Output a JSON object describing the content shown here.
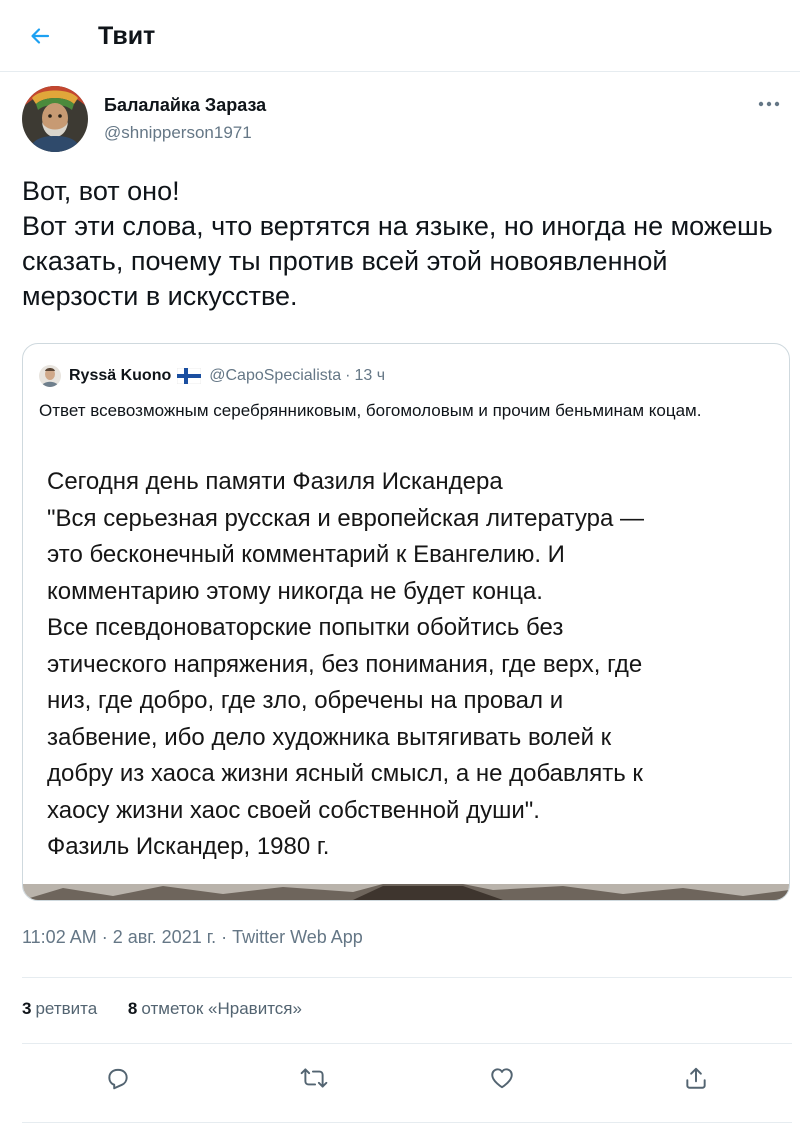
{
  "header": {
    "title": "Твит",
    "back_icon": "arrow-left-icon",
    "accent_color": "#1da1f2"
  },
  "tweet": {
    "author_name": "Балалайка Зараза",
    "author_handle": "@shnipperson1971",
    "more_icon": "more-dots-icon",
    "text": "Вот, вот оно!\nВот эти слова, что вертятся на языке, но иногда не можешь сказать, почему ты против всей этой новоявленной мерзости в искусстве.",
    "timestamp": "11:02 AM · 2 авг. 2021 г. · Twitter Web App"
  },
  "quoted_tweet": {
    "author_name": "Ryssä Kuono",
    "flag_icon": "finland-flag-icon",
    "author_handle": "@CapoSpecialista",
    "separator": "·",
    "time": "13 ч",
    "text": "Ответ всевозможным серебрянниковым, богомоловым и прочим беньминам коцам.",
    "image_text": "Сегодня день памяти Фазиля Искандера\n\"Вся серьезная русская и европейская литература —\nэто бесконечный комментарий к Евангелию. И\nкомментарию этому никогда не будет конца.\nВсе псевдоноваторские попытки обойтись без\nэтического напряжения, без понимания, где верх, где\nниз, где добро, где зло, обречены на провал и\nзабвение, ибо дело художника вытягивать волей к\nдобру из хаоса жизни ясный смысл, а не добавлять к\nхаосу жизни хаос своей собственной души\".\nФазиль Искандер, 1980 г."
  },
  "stats": {
    "retweets_count": "3",
    "retweets_label": "ретвита",
    "likes_count": "8",
    "likes_label": "отметок «Нравится»"
  },
  "actions": {
    "reply_icon": "reply-icon",
    "retweet_icon": "retweet-icon",
    "like_icon": "heart-icon",
    "share_icon": "share-icon"
  }
}
